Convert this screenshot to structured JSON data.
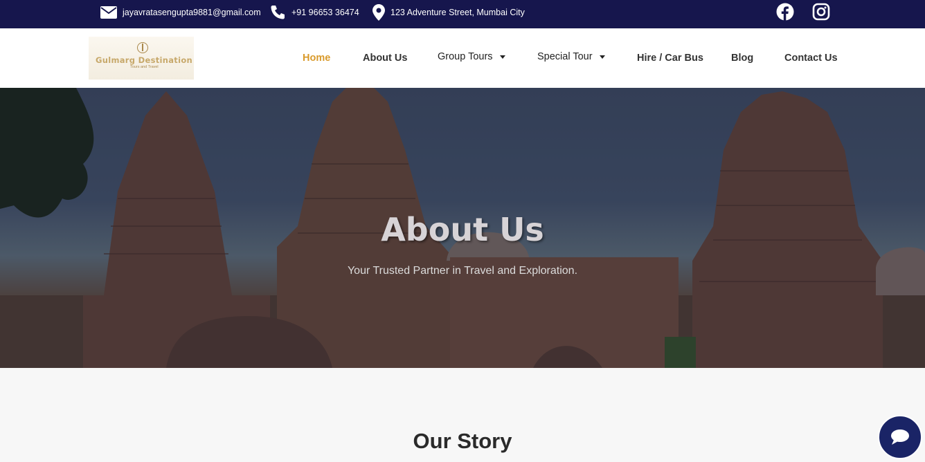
{
  "topbar": {
    "email": "jayavratasengupta9881@gmail.com",
    "phone": "+91 96653 36474",
    "address": "123 Adventure Street, Mumbai City",
    "social": [
      "facebook-icon",
      "instagram-icon"
    ]
  },
  "logo": {
    "name": "Gulmarg Destination",
    "tagline": "Tours and Travel"
  },
  "nav": {
    "home": "Home",
    "about": "About Us",
    "group_tours": "Group Tours",
    "special_tour": "Special Tour",
    "hire": "Hire / Car Bus",
    "blog": "Blog",
    "contact": "Contact Us"
  },
  "hero": {
    "title": "About Us",
    "subtitle": "Your Trusted Partner in Travel and Exploration."
  },
  "story": {
    "title": "Our Story"
  },
  "colors": {
    "topbar_bg": "#16164d",
    "nav_active": "#d99a2b",
    "chat_button": "#1a2466"
  }
}
